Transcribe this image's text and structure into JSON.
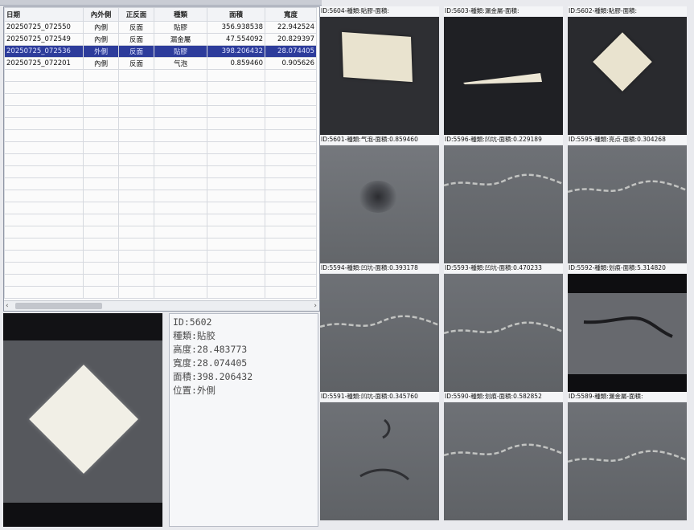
{
  "table": {
    "headers": [
      "日期",
      "內外側",
      "正反面",
      "種類",
      "面積",
      "寬度"
    ],
    "rows": [
      {
        "date": "20250725_072550",
        "side": "內側",
        "face": "反面",
        "type": "貼膠",
        "area": "356.938538",
        "width": "22.942524",
        "selected": false
      },
      {
        "date": "20250725_072549",
        "side": "內側",
        "face": "反面",
        "type": "漏金屬",
        "area": "47.554092",
        "width": "20.829397",
        "selected": false
      },
      {
        "date": "20250725_072536",
        "side": "外側",
        "face": "反面",
        "type": "貼膠",
        "area": "398.206432",
        "width": "28.074405",
        "selected": true
      },
      {
        "date": "20250725_072201",
        "side": "內側",
        "face": "反面",
        "type": "气泡",
        "area": "0.859460",
        "width": "0.905626",
        "selected": false
      }
    ]
  },
  "info": {
    "id": "ID:5602",
    "type": "種類:貼胶",
    "height": "高度:28.483773",
    "width": "寬度:28.074405",
    "area": "面積:398.206432",
    "position": "位置:外側"
  },
  "thumbnails": [
    {
      "caption": "ID:5604-種類:貼膠-面積:",
      "kind": "sheet"
    },
    {
      "caption": "ID:5603-種類:漏金屬-面積:",
      "kind": "strip"
    },
    {
      "caption": "ID:5602-種類:貼膠-面積:",
      "kind": "diamond"
    },
    {
      "caption": "ID:5601-種類:气泡-面積:0.859460",
      "kind": "bubble"
    },
    {
      "caption": "ID:5596-種類:凹坑-面積:0.229189",
      "kind": "crack"
    },
    {
      "caption": "ID:5595-種類:亮点-面積:0.304268",
      "kind": "crack"
    },
    {
      "caption": "ID:5594-種類:凹坑-面積:0.393178",
      "kind": "crack"
    },
    {
      "caption": "ID:5593-種類:凹坑-面積:0.470233",
      "kind": "crack"
    },
    {
      "caption": "ID:5592-種類:划痕-面積:5.314820",
      "kind": "scratch"
    },
    {
      "caption": "ID:5591-種類:凹坑-面積:0.345760",
      "kind": "dents"
    },
    {
      "caption": "ID:5590-種類:划痕-面積:0.582852",
      "kind": "crack"
    },
    {
      "caption": "ID:5589-種類:漏金屬-面積:",
      "kind": "crack"
    }
  ],
  "colors": {
    "selected_row": "#2d3c9b"
  }
}
